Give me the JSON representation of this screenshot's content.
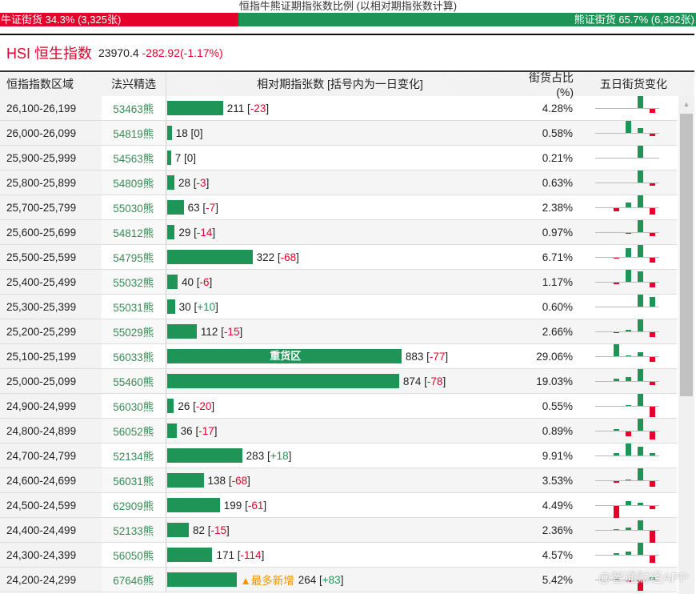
{
  "ratio": {
    "title": "恒指牛熊证期指张数比例 (以相对期指张数计算)",
    "bull_label": "牛证街货 34.3% (3,325张)",
    "bear_label": "熊证街货 65.7% (6,362张)",
    "bull_pct": 34.3,
    "bear_pct": 65.7
  },
  "index": {
    "name": "HSI 恒生指数",
    "value": "23970.4",
    "change": "-282.92(-1.17%)"
  },
  "headers": [
    "恒指指数区域",
    "法兴精选",
    "相对期指张数 [括号内为一日变化]",
    "街货占比(%)",
    "五日街货变化"
  ],
  "colors": {
    "bull": "#e4002b",
    "bear": "#1e9456",
    "tag": "#f39200"
  },
  "rows": [
    {
      "range": "26,100-26,199",
      "code": "53463熊",
      "count": 211,
      "change": "-23",
      "share": "4.28%",
      "five_day": [
        0,
        0,
        0,
        15,
        -5
      ]
    },
    {
      "range": "26,000-26,099",
      "code": "54819熊",
      "count": 18,
      "change": "0",
      "share": "0.58%",
      "five_day": [
        0,
        0,
        15,
        6,
        -3
      ]
    },
    {
      "range": "25,900-25,999",
      "code": "54563熊",
      "count": 7,
      "change": "0",
      "share": "0.21%",
      "five_day": [
        0,
        0,
        0,
        15,
        0
      ]
    },
    {
      "range": "25,800-25,899",
      "code": "54809熊",
      "count": 28,
      "change": "-3",
      "share": "0.63%",
      "five_day": [
        0,
        0,
        0,
        15,
        -3
      ]
    },
    {
      "range": "25,700-25,799",
      "code": "55030熊",
      "count": 63,
      "change": "-7",
      "share": "2.38%",
      "five_day": [
        0,
        -4,
        6,
        15,
        -8
      ]
    },
    {
      "range": "25,600-25,699",
      "code": "54812熊",
      "count": 29,
      "change": "-14",
      "share": "0.97%",
      "five_day": [
        0,
        0,
        -1,
        15,
        -4
      ]
    },
    {
      "range": "25,500-25,599",
      "code": "54795熊",
      "count": 322,
      "change": "-68",
      "share": "6.71%",
      "five_day": [
        0,
        -1,
        11,
        15,
        -6
      ]
    },
    {
      "range": "25,400-25,499",
      "code": "55032熊",
      "count": 40,
      "change": "-6",
      "share": "1.17%",
      "five_day": [
        0,
        -2,
        15,
        13,
        -6
      ]
    },
    {
      "range": "25,300-25,399",
      "code": "55031熊",
      "count": 30,
      "change": "+10",
      "share": "0.60%",
      "five_day": [
        0,
        0,
        0,
        15,
        12
      ]
    },
    {
      "range": "25,200-25,299",
      "code": "55029熊",
      "count": 112,
      "change": "-15",
      "share": "2.66%",
      "five_day": [
        0,
        -1,
        2,
        15,
        -6
      ]
    },
    {
      "range": "25,100-25,199",
      "code": "56033熊",
      "count": 883,
      "change": "-77",
      "share": "29.06%",
      "label": "重货区",
      "five_day": [
        0,
        15,
        1,
        5,
        -6
      ]
    },
    {
      "range": "25,000-25,099",
      "code": "55460熊",
      "count": 874,
      "change": "-78",
      "share": "19.03%",
      "five_day": [
        0,
        3,
        5,
        15,
        -4
      ]
    },
    {
      "range": "24,900-24,999",
      "code": "56030熊",
      "count": 26,
      "change": "-20",
      "share": "0.55%",
      "five_day": [
        0,
        0,
        1,
        15,
        -13
      ]
    },
    {
      "range": "24,800-24,899",
      "code": "56052熊",
      "count": 36,
      "change": "-17",
      "share": "0.89%",
      "five_day": [
        0,
        2,
        -6,
        15,
        -10
      ]
    },
    {
      "range": "24,700-24,799",
      "code": "52134熊",
      "count": 283,
      "change": "+18",
      "share": "9.91%",
      "five_day": [
        0,
        3,
        15,
        11,
        3
      ]
    },
    {
      "range": "24,600-24,699",
      "code": "56031熊",
      "count": 138,
      "change": "-68",
      "share": "3.53%",
      "five_day": [
        0,
        -2,
        1,
        15,
        -7
      ]
    },
    {
      "range": "24,500-24,599",
      "code": "62909熊",
      "count": 199,
      "change": "-61",
      "share": "4.49%",
      "five_day": [
        0,
        -15,
        5,
        3,
        -4
      ]
    },
    {
      "range": "24,400-24,499",
      "code": "52133熊",
      "count": 82,
      "change": "-15",
      "share": "2.36%",
      "five_day": [
        0,
        1,
        3,
        12,
        -15
      ]
    },
    {
      "range": "24,300-24,399",
      "code": "56050熊",
      "count": 171,
      "change": "-114",
      "share": "4.57%",
      "five_day": [
        0,
        2,
        4,
        15,
        -9
      ]
    },
    {
      "range": "24,200-24,299",
      "code": "67646熊",
      "count": 264,
      "change": "+83",
      "share": "5.42%",
      "tag": "▲最多新增",
      "five_day": [
        0,
        2,
        -2,
        -13,
        3
      ]
    }
  ],
  "watermark": "@智通财经APP"
}
